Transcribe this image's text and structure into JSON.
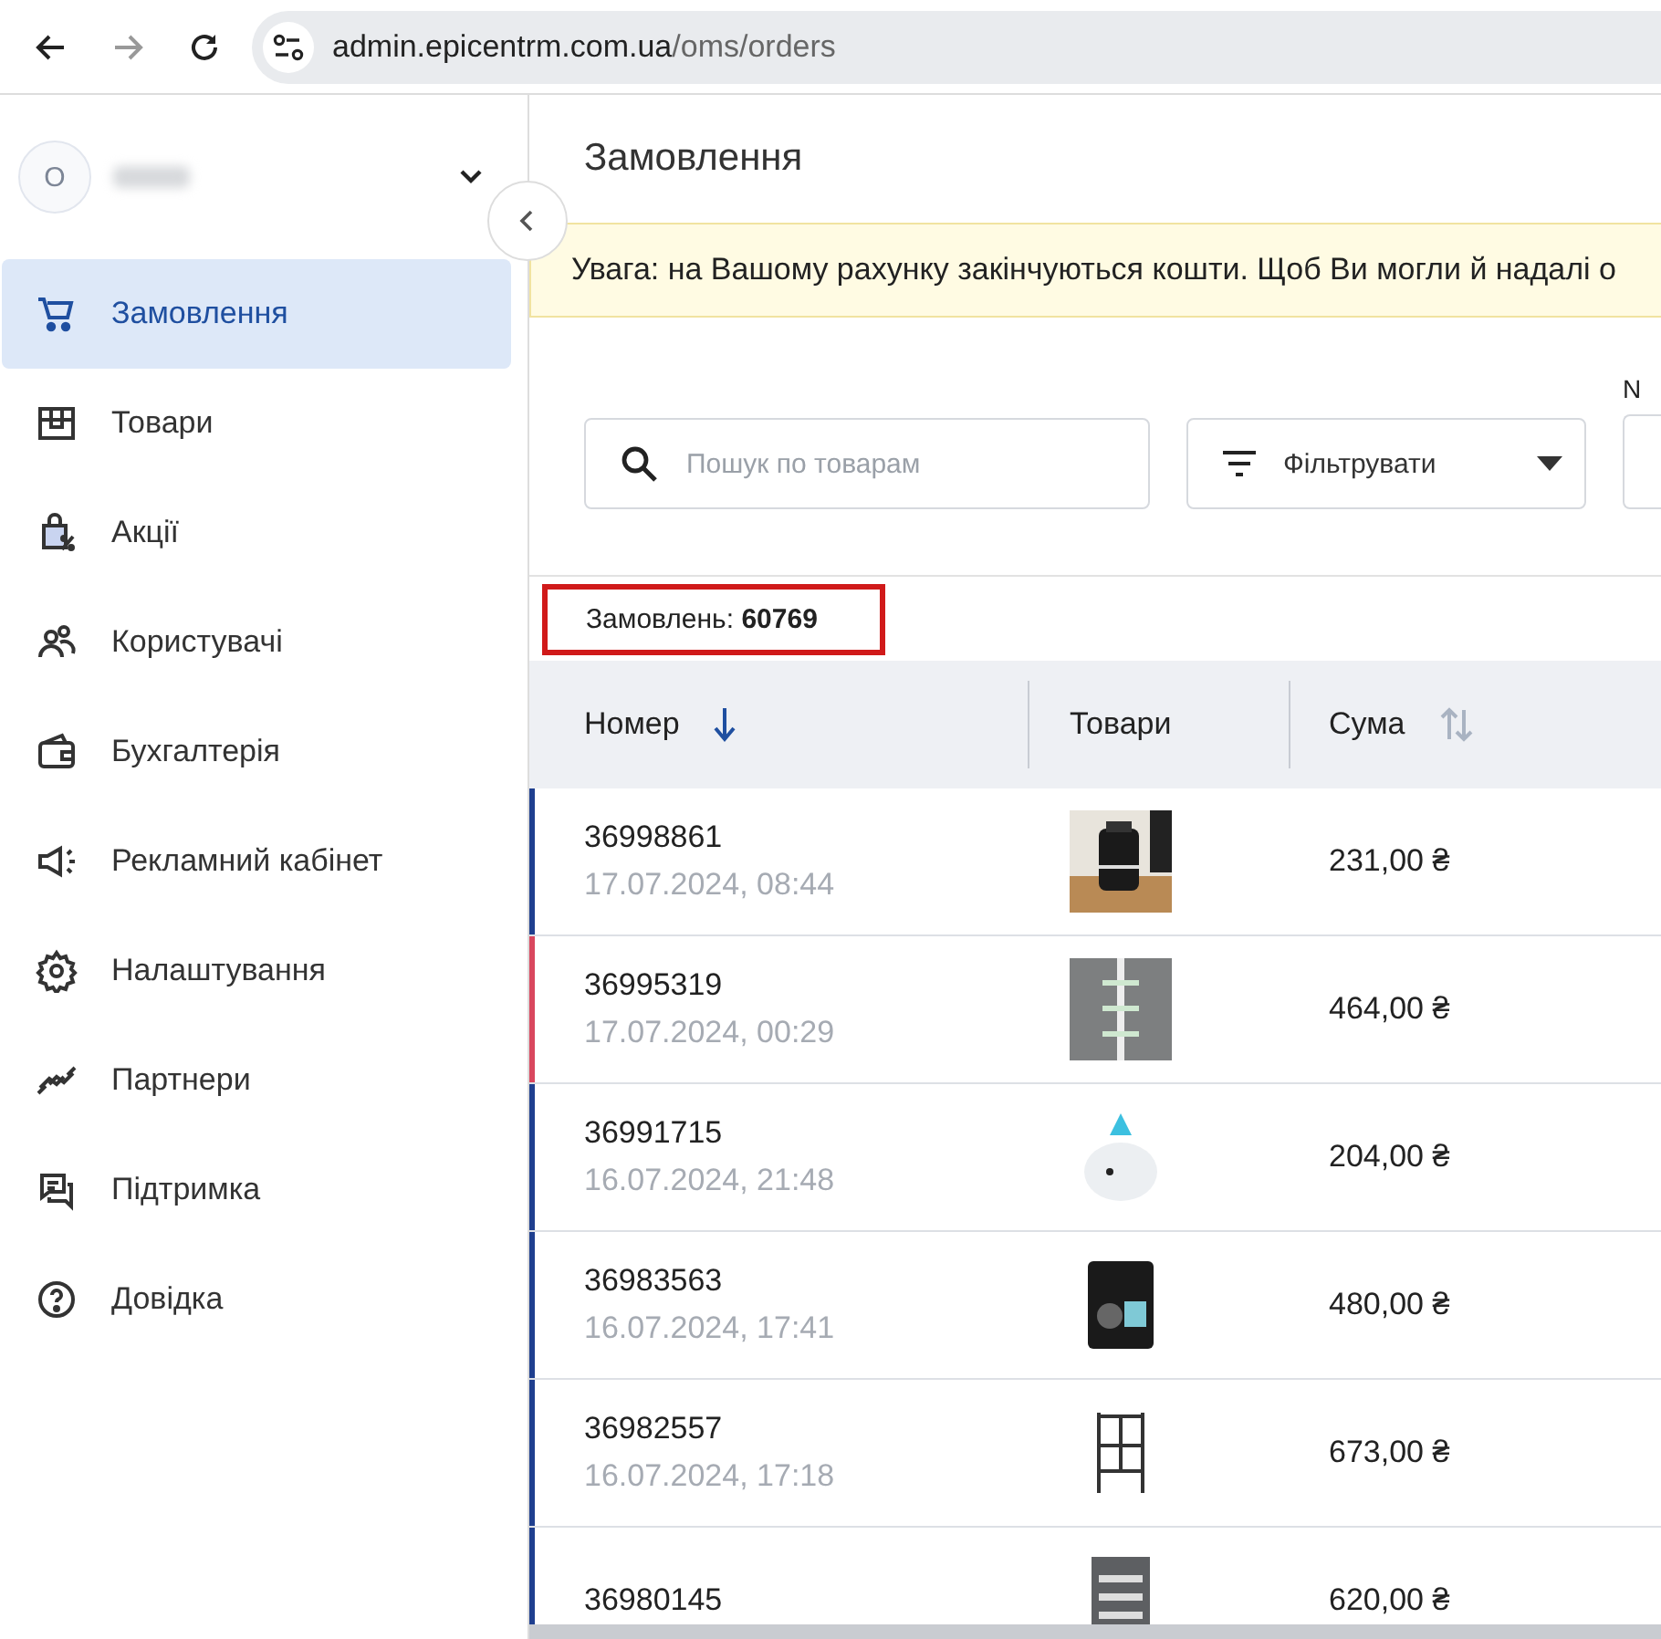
{
  "browser": {
    "url_host": "admin.epicentrm.com.ua",
    "url_path": "/oms/orders"
  },
  "account": {
    "avatar_letter": "O"
  },
  "sidebar": {
    "items": [
      {
        "label": "Замовлення",
        "selected": true
      },
      {
        "label": "Товари",
        "selected": false
      },
      {
        "label": "Акції",
        "selected": false
      },
      {
        "label": "Користувачі",
        "selected": false
      },
      {
        "label": "Бухгалтерія",
        "selected": false
      },
      {
        "label": "Рекламний кабінет",
        "selected": false
      },
      {
        "label": "Налаштування",
        "selected": false
      },
      {
        "label": "Партнери",
        "selected": false
      },
      {
        "label": "Підтримка",
        "selected": false
      },
      {
        "label": "Довідка",
        "selected": false
      }
    ]
  },
  "page": {
    "title": "Замовлення",
    "warning": "Увага: на Вашому рахунку закінчуються кошти. Щоб Ви могли й надалі о"
  },
  "filters": {
    "search_placeholder": "Пошук по товарам",
    "filter_label": "Фільтрувати",
    "cut_label": "N"
  },
  "count": {
    "label": "Замовлень:",
    "value": "60769"
  },
  "table": {
    "columns": [
      {
        "label": "Номер",
        "kind": "sorted"
      },
      {
        "label": "Товари",
        "kind": "plain"
      },
      {
        "label": "Сума",
        "kind": "sortable"
      }
    ],
    "rows": [
      {
        "number": "36998861",
        "date": "17.07.2024, 08:44",
        "sum": "231,00 ₴",
        "color": "#1f3f8f"
      },
      {
        "number": "36995319",
        "date": "17.07.2024, 00:29",
        "sum": "464,00 ₴",
        "color": "#d9475e"
      },
      {
        "number": "36991715",
        "date": "16.07.2024, 21:48",
        "sum": "204,00 ₴",
        "color": "#1f3f8f"
      },
      {
        "number": "36983563",
        "date": "16.07.2024, 17:41",
        "sum": "480,00 ₴",
        "color": "#1f3f8f"
      },
      {
        "number": "36982557",
        "date": "16.07.2024, 17:18",
        "sum": "673,00 ₴",
        "color": "#1f3f8f"
      },
      {
        "number": "36980145",
        "sum": "620,00 ₴",
        "color": "#1f3f8f"
      }
    ]
  }
}
